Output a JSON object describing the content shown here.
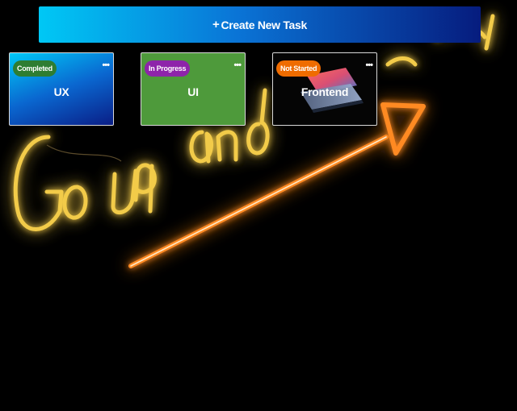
{
  "create_button": {
    "icon": "plus-icon",
    "symbol": "+",
    "label": "Create New Task",
    "gradient": [
      "#00c8f5",
      "#0a74d6",
      "#061c7e"
    ]
  },
  "tasks": [
    {
      "title": "UX",
      "status": "Completed",
      "status_color": "#2e7d32",
      "menu_icon": "ellipsis-icon",
      "menu_symbol": "•••"
    },
    {
      "title": "UI",
      "status": "In Progress",
      "status_color": "#8e24aa",
      "menu_icon": "ellipsis-icon",
      "menu_symbol": "•••"
    },
    {
      "title": "Frontend",
      "status": "Not Started",
      "status_color": "#ef6c00",
      "menu_icon": "ellipsis-icon",
      "menu_symbol": "•••"
    }
  ],
  "colors": {
    "page_background": "#000000",
    "neon_text": "#ffcf3a",
    "neon_arrow": "#ff7a1a"
  }
}
